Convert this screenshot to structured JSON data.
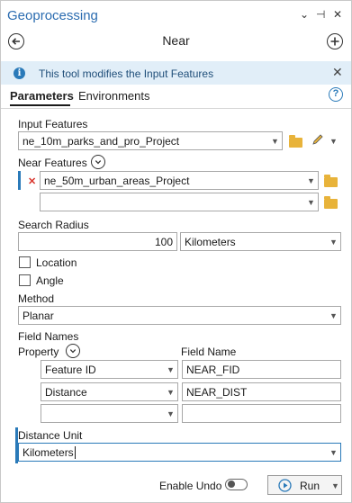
{
  "pane": {
    "title": "Geoprocessing",
    "controls": {
      "menu": "⌄",
      "pin": "⊣",
      "close": "✕"
    }
  },
  "tool": {
    "name": "Near",
    "back_icon": "arrow-left-circle-icon",
    "add_icon": "plus-circle-icon"
  },
  "info_bar": {
    "icon": "i",
    "message": "This tool modifies the Input Features",
    "close": "✕"
  },
  "tabs": [
    {
      "label": "Parameters",
      "active": true
    },
    {
      "label": "Environments",
      "active": false
    }
  ],
  "help": "?",
  "params": {
    "input_features": {
      "label": "Input Features",
      "value": "ne_10m_parks_and_pro_Project"
    },
    "near_features": {
      "label": "Near Features",
      "rows": [
        {
          "value": "ne_50m_urban_areas_Project",
          "remove": "✕"
        },
        {
          "value": ""
        }
      ]
    },
    "search_radius": {
      "label": "Search Radius",
      "value": "100",
      "unit": "Kilometers"
    },
    "location": {
      "label": "Location",
      "checked": false
    },
    "angle": {
      "label": "Angle",
      "checked": false
    },
    "method": {
      "label": "Method",
      "value": "Planar"
    },
    "field_names": {
      "label": "Field Names",
      "property_header": "Property",
      "field_name_header": "Field Name",
      "rows": [
        {
          "property": "Feature ID",
          "field_name": "NEAR_FID"
        },
        {
          "property": "Distance",
          "field_name": "NEAR_DIST"
        },
        {
          "property": "",
          "field_name": ""
        }
      ]
    },
    "distance_unit": {
      "label": "Distance Unit",
      "value": "Kilometers"
    }
  },
  "footer": {
    "enable_undo_label": "Enable Undo",
    "enable_undo_on": false,
    "run_label": "Run"
  },
  "colors": {
    "accent": "#2a7ab9",
    "title": "#2b6cb0",
    "info_bg": "#e1eef8",
    "folder": "#e8b33a",
    "error_x": "#d9342b"
  }
}
